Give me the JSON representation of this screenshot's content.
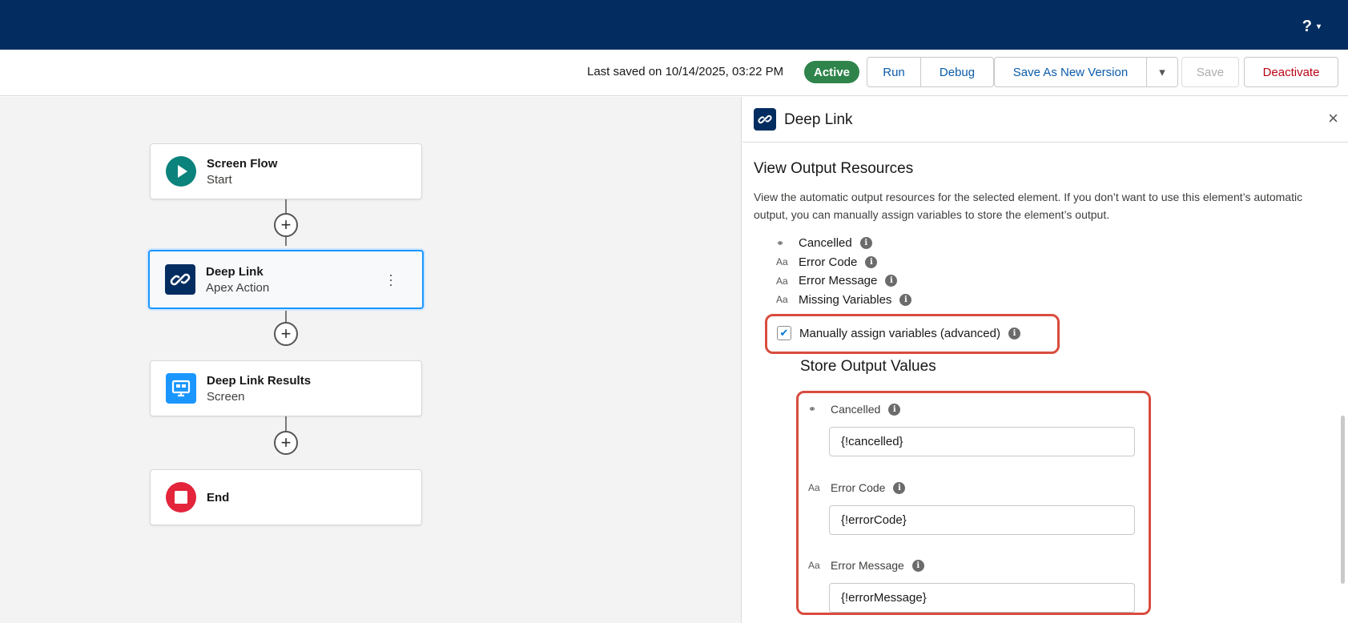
{
  "topbar": {
    "help_label": "?",
    "caret": "▾"
  },
  "toolbar": {
    "last_saved": "Last saved on 10/14/2025, 03:22 PM",
    "status": "Active",
    "status_color": "#2e844a",
    "run": "Run",
    "debug": "Debug",
    "save_as_new": "Save As New Version",
    "caret": "▾",
    "save": "Save",
    "deactivate": "Deactivate"
  },
  "canvas": {
    "nodes": [
      {
        "title": "Screen Flow",
        "subtitle": "Start",
        "icon": "play-icon",
        "color": "#0b827c"
      },
      {
        "title": "Deep Link",
        "subtitle": "Apex Action",
        "icon": "link-icon",
        "color": "#032d60",
        "selected": true
      },
      {
        "title": "Deep Link Results",
        "subtitle": "Screen",
        "icon": "screen-icon",
        "color": "#1b96ff"
      },
      {
        "title": "End",
        "subtitle": "",
        "icon": "stop-icon",
        "color": "#e3243b"
      }
    ],
    "add_label": "+"
  },
  "panel": {
    "title": "Deep Link",
    "close": "×",
    "section_title": "View Output Resources",
    "description": "View the automatic output resources for the selected element. If you don’t want to use this element’s automatic output, you can manually assign variables to store the element’s output.",
    "outputs": [
      {
        "label": "Cancelled",
        "type_icon": "boolean-icon"
      },
      {
        "label": "Error Code",
        "type_icon": "text-icon"
      },
      {
        "label": "Error Message",
        "type_icon": "text-icon"
      },
      {
        "label": "Missing Variables",
        "type_icon": "text-icon"
      }
    ],
    "manual_assign_label": "Manually assign variables (advanced)",
    "manual_assign_checked": true,
    "store_title": "Store Output Values",
    "fields": [
      {
        "label": "Cancelled",
        "value": "{!cancelled}",
        "type_icon": "boolean-icon"
      },
      {
        "label": "Error Code",
        "value": "{!errorCode}",
        "type_icon": "text-icon"
      },
      {
        "label": "Error Message",
        "value": "{!errorMessage}",
        "type_icon": "text-icon"
      }
    ],
    "info_glyph": "i"
  }
}
